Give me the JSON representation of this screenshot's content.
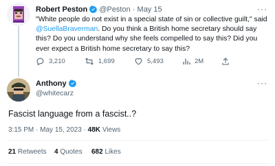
{
  "quoted_tweet": {
    "author_name": "Robert Peston",
    "handle": "@Peston",
    "separator": "·",
    "date": "May 15",
    "more": "···",
    "text_part1": "\"White people do not exist in a special state of sin or collective guilt,\" said ",
    "mention": "@SuellaBraverman",
    "text_part2": ". Do you think a British home secretary should say this? Do you understand why she feels compelled to say this? Did you ever expect a British home secretary to say this?",
    "actions": [
      {
        "icon": "reply-icon",
        "count": "3,210"
      },
      {
        "icon": "retweet-icon",
        "count": "1,699"
      },
      {
        "icon": "like-icon",
        "count": "5,493"
      },
      {
        "icon": "views-icon",
        "count": "2M"
      },
      {
        "icon": "share-icon",
        "count": ""
      }
    ]
  },
  "main_tweet": {
    "author_name": "Anthony",
    "handle": "@whitecarz",
    "more": "···",
    "text": "Fascist language from a fascist..?",
    "time": "3:15 PM",
    "separator": "·",
    "date": "May 15, 2023",
    "separator2": "·",
    "views_count": "48K",
    "views_label": "Views"
  },
  "stats": {
    "retweets_count": "21",
    "retweets_label": "Retweets",
    "quotes_count": "4",
    "quotes_label": "Quotes",
    "likes_count": "682",
    "likes_label": "Likes"
  },
  "colors": {
    "accent": "#1d9bf0",
    "muted": "#536471",
    "text": "#0f1419",
    "divider": "#eff3f4"
  }
}
